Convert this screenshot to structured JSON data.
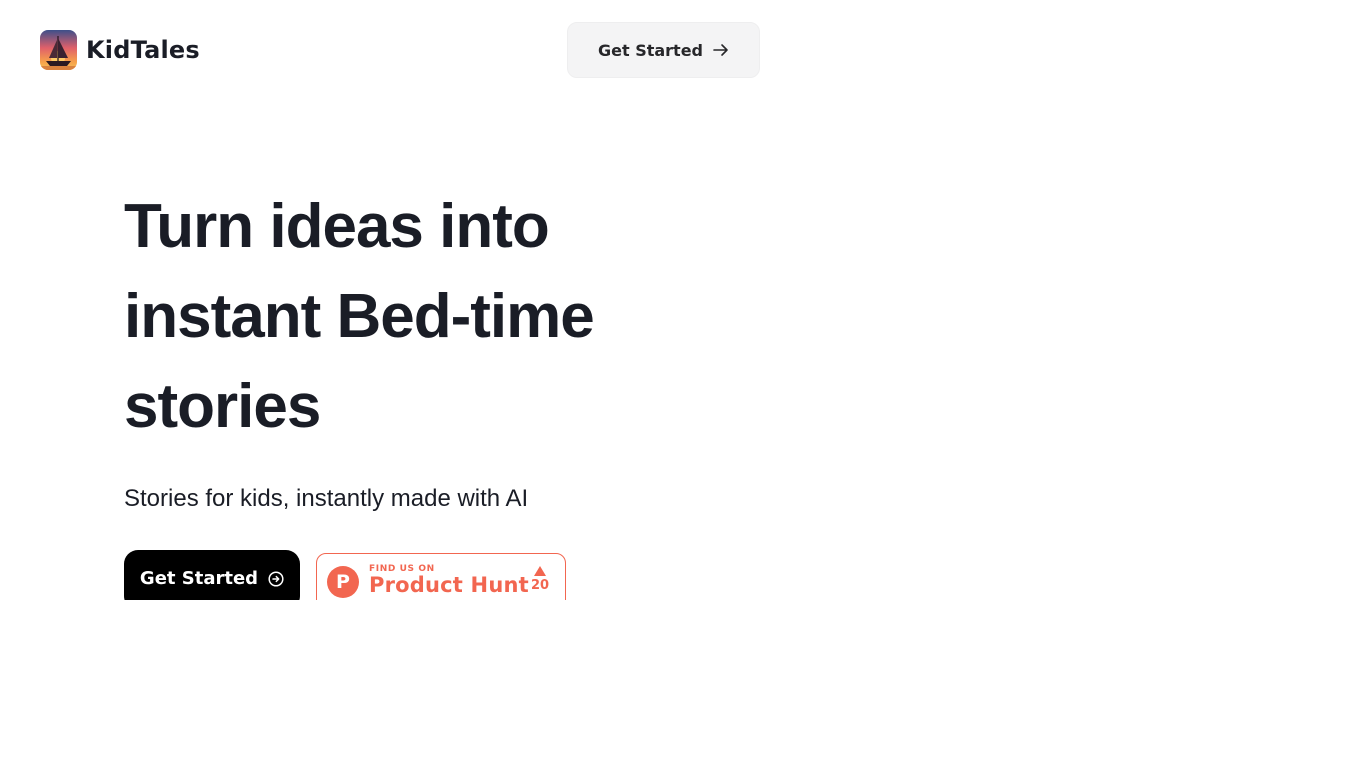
{
  "header": {
    "brand_name": "KidTales",
    "cta_label": "Get Started",
    "cta_icon": "arrow-right-icon"
  },
  "hero": {
    "title_lines": [
      "Turn ideas into",
      "instant Bed-time",
      "stories"
    ],
    "subtitle": "Stories for kids, instantly made with AI",
    "primary_cta_label": "Get Started",
    "primary_cta_icon": "arrow-circle-right-icon"
  },
  "product_hunt": {
    "eyebrow": "FIND US ON",
    "name": "Product Hunt",
    "logo_letter": "P",
    "upvotes": "20"
  },
  "colors": {
    "text": "#1a1d26",
    "primary_button": "#000000",
    "product_hunt": "#f26650",
    "nav_button_bg": "#f4f4f5"
  }
}
